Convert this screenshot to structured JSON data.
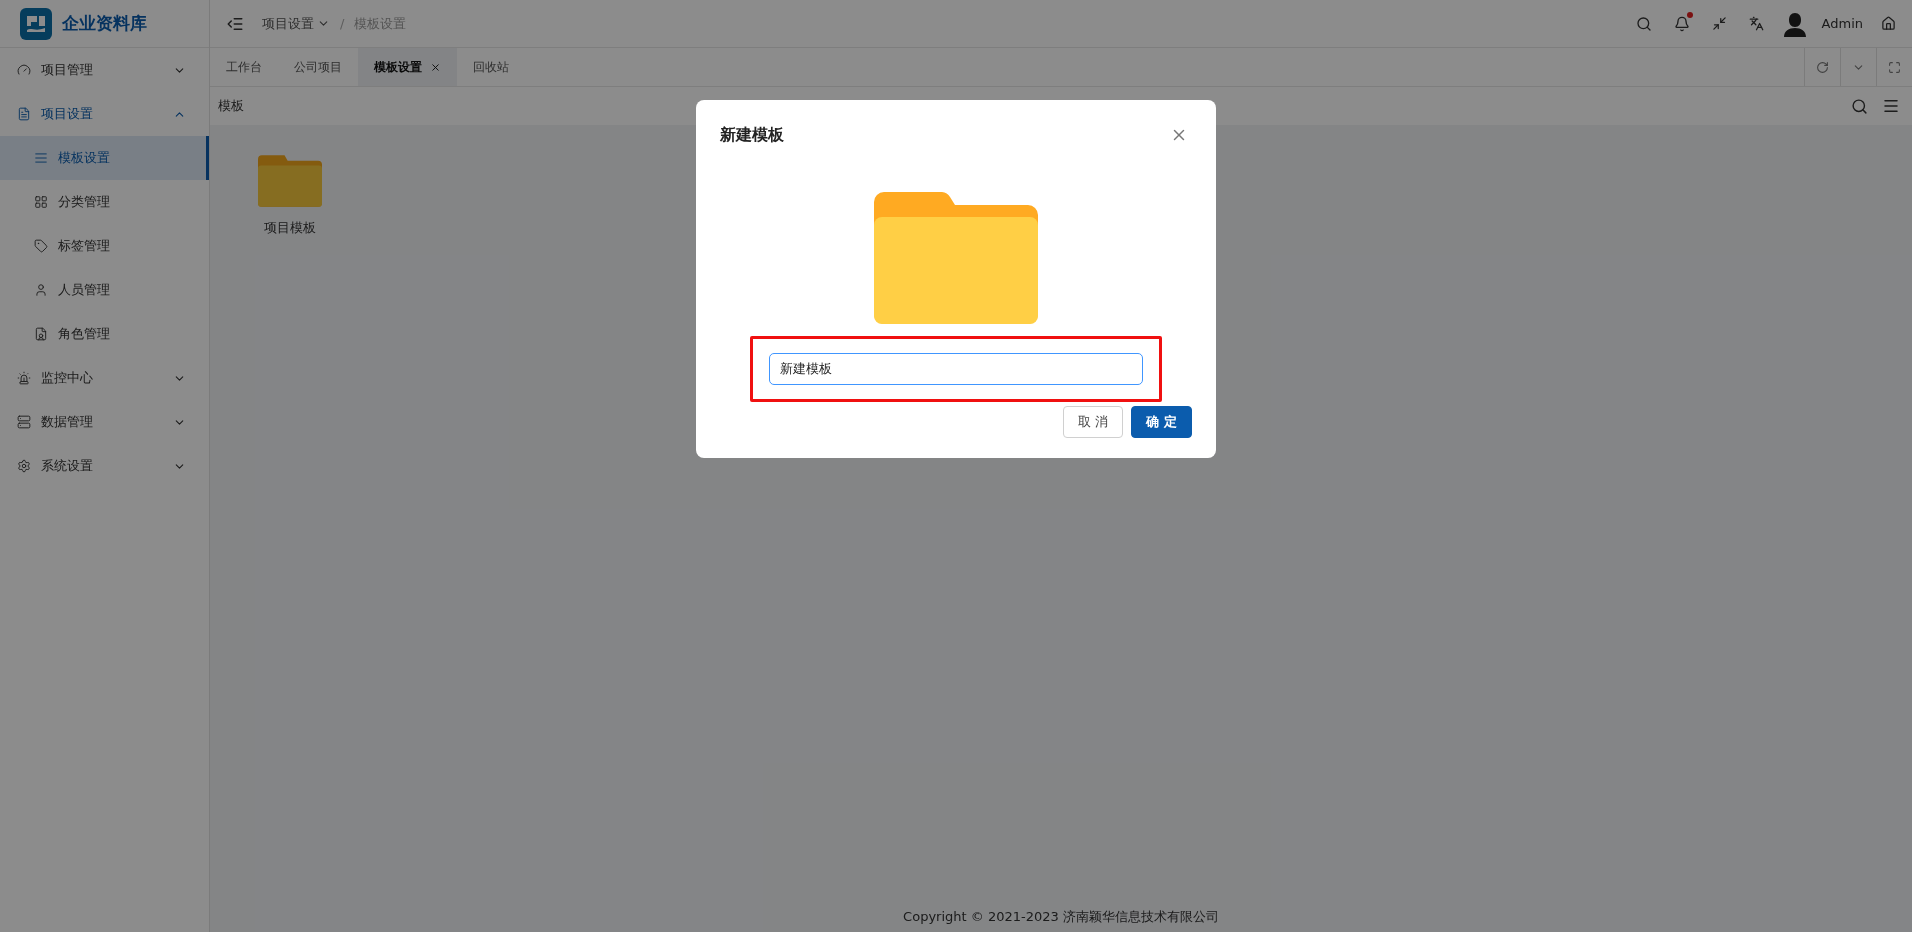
{
  "app": {
    "logo_text": "企业资料库"
  },
  "sidebar": {
    "items": [
      {
        "label": "项目管理",
        "expanded": false
      },
      {
        "label": "项目设置",
        "expanded": true,
        "children": [
          {
            "label": "模板设置",
            "selected": true
          },
          {
            "label": "分类管理",
            "selected": false
          },
          {
            "label": "标签管理",
            "selected": false
          },
          {
            "label": "人员管理",
            "selected": false
          },
          {
            "label": "角色管理",
            "selected": false
          }
        ]
      },
      {
        "label": "监控中心",
        "expanded": false
      },
      {
        "label": "数据管理",
        "expanded": false
      },
      {
        "label": "系统设置",
        "expanded": false
      }
    ]
  },
  "header": {
    "breadcrumb": [
      {
        "label": "项目设置",
        "dropdown": true
      },
      {
        "label": "模板设置",
        "dropdown": false
      }
    ],
    "breadcrumb_separator": "/",
    "notifications_unread": true,
    "user": "Admin"
  },
  "tabs": [
    {
      "label": "工作台",
      "selected": false
    },
    {
      "label": "公司项目",
      "selected": false
    },
    {
      "label": "模板设置",
      "selected": true
    },
    {
      "label": "回收站",
      "selected": false
    }
  ],
  "toolbar": {
    "title": "模板"
  },
  "folders": [
    {
      "name": "项目模板"
    }
  ],
  "modal": {
    "title": "新建模板",
    "input_value": "新建模板",
    "highlighted": true,
    "buttons": [
      {
        "label": "取 消",
        "kind": "secondary"
      },
      {
        "label": "确 定",
        "kind": "primary"
      }
    ]
  },
  "footer": {
    "copyright": "Copyright © 2021-2023 济南颖华信息技术有限公司"
  }
}
